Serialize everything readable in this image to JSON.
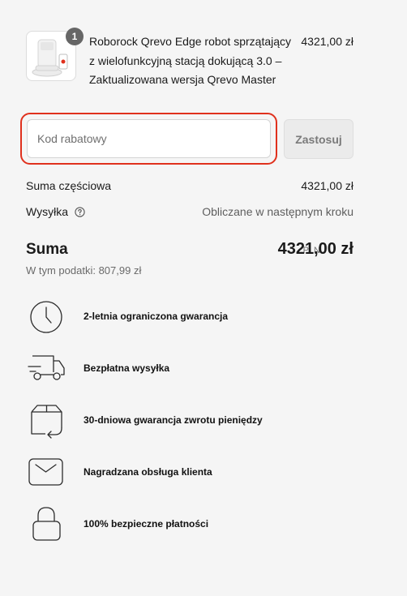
{
  "cart": {
    "item": {
      "quantity": "1",
      "name": "Roborock Qrevo Edge robot sprzątający z wielofunkcyjną stacją dokującą 3.0 – Zaktualizowana wersja Qrevo Master",
      "price": "4321,00 zł",
      "image_icon": "robot-vacuum-product-image"
    }
  },
  "discount": {
    "placeholder": "Kod rabatowy",
    "value": "",
    "apply_label": "Zastosuj",
    "focus_color": "#e0311d"
  },
  "summary": {
    "subtotal_label": "Suma częściowa",
    "subtotal_value": "4321,00 zł",
    "shipping_label": "Wysyłka",
    "shipping_value": "Obliczane w następnym kroku",
    "total_label": "Suma",
    "total_currency": "PLN",
    "total_value": "4321,00 zł",
    "tax_note": "W tym podatki: 807,99 zł"
  },
  "features": [
    {
      "icon": "clock-icon",
      "label": "2-letnia ograniczona gwarancja"
    },
    {
      "icon": "delivery-truck-icon",
      "label": "Bezpłatna wysyłka"
    },
    {
      "icon": "return-box-icon",
      "label": "30-dniowa gwarancja zwrotu pieniędzy"
    },
    {
      "icon": "envelope-icon",
      "label": "Nagradzana obsługa klienta"
    },
    {
      "icon": "padlock-icon",
      "label": "100% bezpieczne płatności"
    }
  ]
}
